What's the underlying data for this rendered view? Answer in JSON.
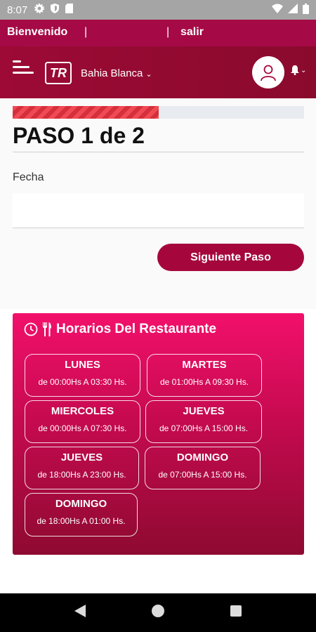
{
  "status": {
    "time": "8:07"
  },
  "welcome": {
    "greeting": "Bienvenido",
    "separator": "|",
    "logout": "salir"
  },
  "header": {
    "logo_text": "TR",
    "city": "Bahia Blanca"
  },
  "progress": {
    "value_percent": 50
  },
  "step": {
    "title": "PASO 1 de 2"
  },
  "form": {
    "fecha_label": "Fecha",
    "fecha_value": ""
  },
  "next_button": "Siguiente Paso",
  "horarios": {
    "title": "Horarios Del Restaurante",
    "days": [
      {
        "name": "LUNES",
        "hours": "de 00:00Hs A 03:30 Hs."
      },
      {
        "name": "MARTES",
        "hours": "de 01:00Hs A 09:30 Hs."
      },
      {
        "name": "MIERCOLES",
        "hours": "de 00:00Hs A 07:30 Hs."
      },
      {
        "name": "JUEVES",
        "hours": "de 07:00Hs A 15:00 Hs."
      },
      {
        "name": "JUEVES",
        "hours": "de 18:00Hs A 23:00 Hs."
      },
      {
        "name": "DOMINGO",
        "hours": "de 07:00Hs A 15:00 Hs."
      },
      {
        "name": "DOMINGO",
        "hours": "de 18:00Hs A 01:00 Hs."
      }
    ]
  },
  "colors": {
    "brand": "#a5073d",
    "card_top": "#f2106b",
    "card_bottom": "#8e0a31"
  }
}
